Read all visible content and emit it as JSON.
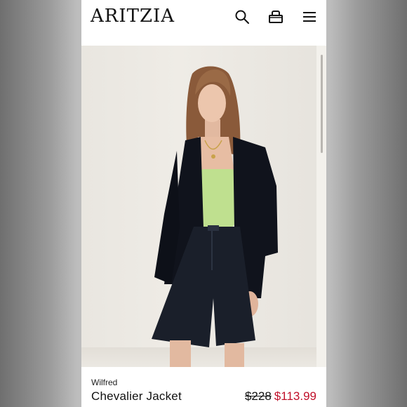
{
  "header": {
    "logo": "ARITZIA",
    "icons": [
      "search-icon",
      "shopping-bag-icon",
      "menu-icon"
    ]
  },
  "product": {
    "brand": "Wilfred",
    "name": "Chevalier Jacket",
    "original_price": "$228",
    "sale_price": "$113.99"
  },
  "colors": {
    "sale_price": "#c0102a",
    "text": "#111111",
    "background": "#ffffff"
  }
}
